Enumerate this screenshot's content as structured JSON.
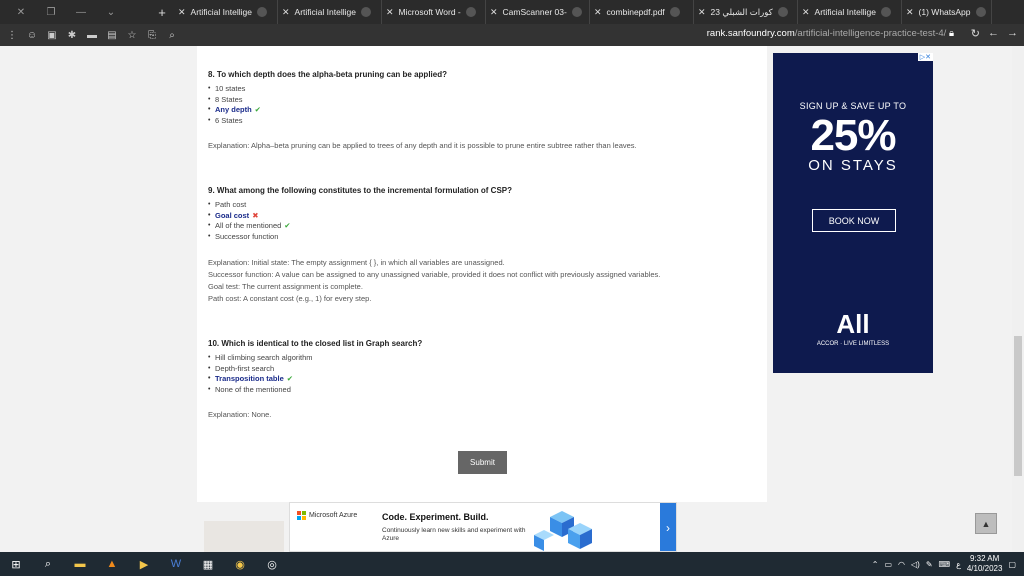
{
  "browser": {
    "tabs": [
      {
        "label": "Artificial Intellige"
      },
      {
        "label": "Artificial Intellige"
      },
      {
        "label": "Microsoft Word -"
      },
      {
        "label": "CamScanner 03-"
      },
      {
        "label": "combinepdf.pdf"
      },
      {
        "label": "كورات الشبلي 23"
      },
      {
        "label": "Artificial Intellige"
      },
      {
        "label": "(1) WhatsApp"
      }
    ],
    "url_domain": "rank.sanfoundry.com",
    "url_path": "/artificial-intelligence-practice-test-4/"
  },
  "questions": [
    {
      "title": "8. To which depth does the alpha-beta pruning can be applied?",
      "options": [
        {
          "text": "10 states",
          "selected": false,
          "mark": ""
        },
        {
          "text": "8 States",
          "selected": false,
          "mark": ""
        },
        {
          "text": "Any depth",
          "selected": true,
          "mark": "✔"
        },
        {
          "text": "6 States",
          "selected": false,
          "mark": ""
        }
      ],
      "explanation": [
        "Explanation: Alpha–beta pruning can be applied to trees of any depth and it is possible to prune entire subtree rather than leaves."
      ]
    },
    {
      "title": "9. What among the following constitutes to the incremental formulation of CSP?",
      "options": [
        {
          "text": "Path cost",
          "selected": false,
          "mark": ""
        },
        {
          "text": "Goal cost",
          "selected": true,
          "mark": "✖"
        },
        {
          "text": "All of the mentioned",
          "selected": false,
          "mark": "✔"
        },
        {
          "text": "Successor function",
          "selected": false,
          "mark": ""
        }
      ],
      "explanation": [
        "Explanation: Initial state: The empty assignment { }, in which all variables are unassigned.",
        "Successor function: A value can be assigned to any unassigned variable, provided it does not conflict with previously assigned variables.",
        "Goal test: The current assignment is complete.",
        "Path cost: A constant cost (e.g., 1) for every step."
      ]
    },
    {
      "title": "10. Which is identical to the closed list in Graph search?",
      "options": [
        {
          "text": "Hill climbing search algorithm",
          "selected": false,
          "mark": ""
        },
        {
          "text": "Depth-first search",
          "selected": false,
          "mark": ""
        },
        {
          "text": "Transposition table",
          "selected": true,
          "mark": "✔"
        },
        {
          "text": "None of the mentioned",
          "selected": false,
          "mark": ""
        }
      ],
      "explanation": [
        "Explanation: None."
      ]
    }
  ],
  "submit_label": "Submit",
  "side_ad": {
    "line1": "SIGN UP & SAVE UP TO",
    "line2": "25%",
    "line3": "ON STAYS",
    "button": "BOOK NOW",
    "brand": "All",
    "tagline": "ACCOR · LIVE LIMITLESS"
  },
  "bottom_ad": {
    "brand": "Microsoft Azure",
    "headline": "Code. Experiment. Build.",
    "sub": "Continuously learn new skills and experiment with Azure"
  },
  "taskbar": {
    "time": "9:32 AM",
    "date": "4/10/2023",
    "lang": "ع"
  }
}
